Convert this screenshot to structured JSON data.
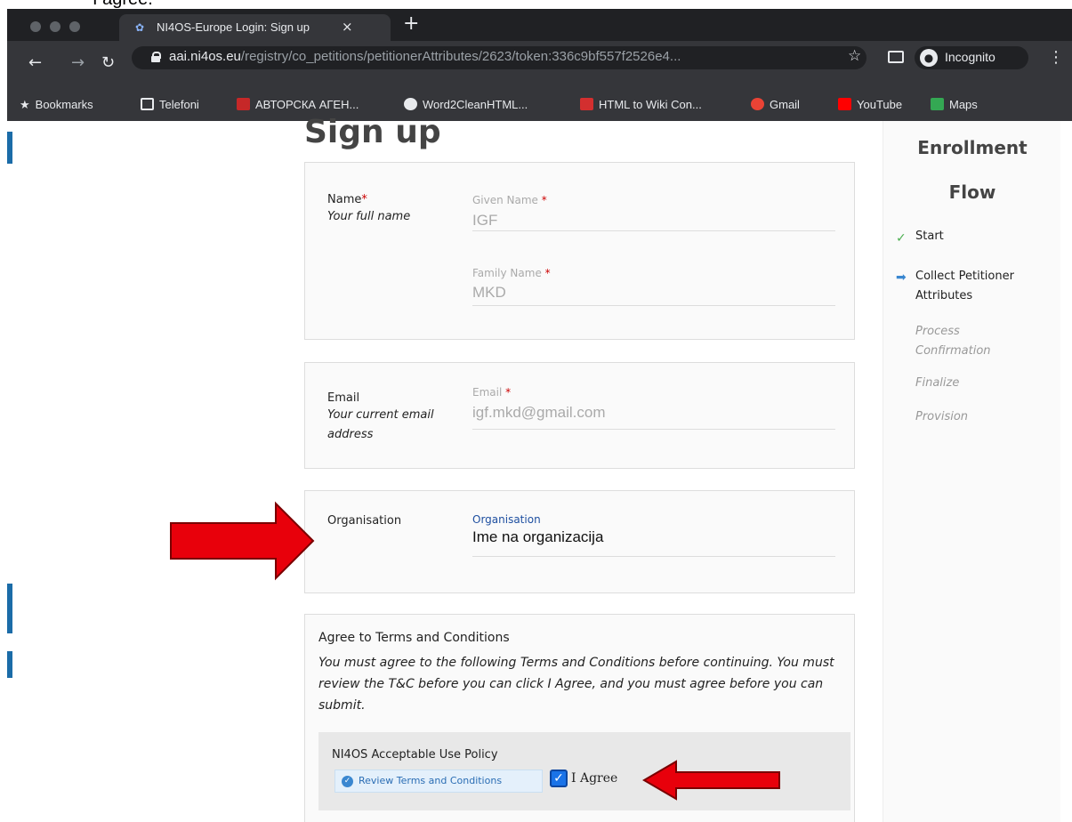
{
  "doc": {
    "snippet": "I agree."
  },
  "browser": {
    "tab_title": "NI4OS-Europe Login: Sign up",
    "tab_close": "×",
    "new_tab": "+",
    "url_host": "aai.ni4os.eu",
    "url_path": "/registry/co_petitions/petitionerAttributes/2623/token:336c9bf557f2526e4...",
    "incognito_label": "Incognito",
    "bookmarks": [
      {
        "label": "Bookmarks",
        "icon": "star-icon"
      },
      {
        "label": "Telefoni",
        "icon": "folder-icon"
      },
      {
        "label": "АВТОРСКА АГЕН...",
        "icon": "agency-icon"
      },
      {
        "label": "Word2CleanHTML...",
        "icon": "globe-icon"
      },
      {
        "label": "HTML to Wiki Con...",
        "icon": "flash-icon"
      },
      {
        "label": "Gmail",
        "icon": "google-icon"
      },
      {
        "label": "YouTube",
        "icon": "youtube-icon"
      },
      {
        "label": "Maps",
        "icon": "maps-icon"
      }
    ]
  },
  "page": {
    "title": "Sign up",
    "name_section": {
      "label": "Name",
      "required_mark": "*",
      "description": "Your full name",
      "given_label": "Given Name",
      "given_value": "IGF",
      "family_label": "Family Name",
      "family_value": "MKD"
    },
    "email_section": {
      "label": "Email",
      "description": "Your current email address",
      "field_label": "Email",
      "field_value": "igf.mkd@gmail.com"
    },
    "org_section": {
      "label": "Organisation",
      "field_label": "Organisation",
      "field_value": "Ime na organizacija"
    },
    "terms": {
      "title": "Agree to Terms and Conditions",
      "text": "You must agree to the following Terms and Conditions before continuing. You must review the T&C before you can click I Agree, and you must agree before you can submit.",
      "policy_title": "NI4OS Acceptable Use Policy",
      "review_button": "Review Terms and Conditions",
      "agree_label": "I Agree",
      "agree_checked": true
    }
  },
  "sidebar": {
    "title_line1": "Enrollment",
    "title_line2": "Flow",
    "steps": [
      {
        "label": "Start",
        "state": "done"
      },
      {
        "label": "Collect Petitioner Attributes",
        "state": "current"
      },
      {
        "label": "Process Confirmation",
        "state": "future"
      },
      {
        "label": "Finalize",
        "state": "future"
      },
      {
        "label": "Provision",
        "state": "future"
      }
    ]
  },
  "colors": {
    "annotation_arrow": "#e8000b",
    "accent_blue": "#1b6ca8",
    "required": "#cc0000"
  }
}
